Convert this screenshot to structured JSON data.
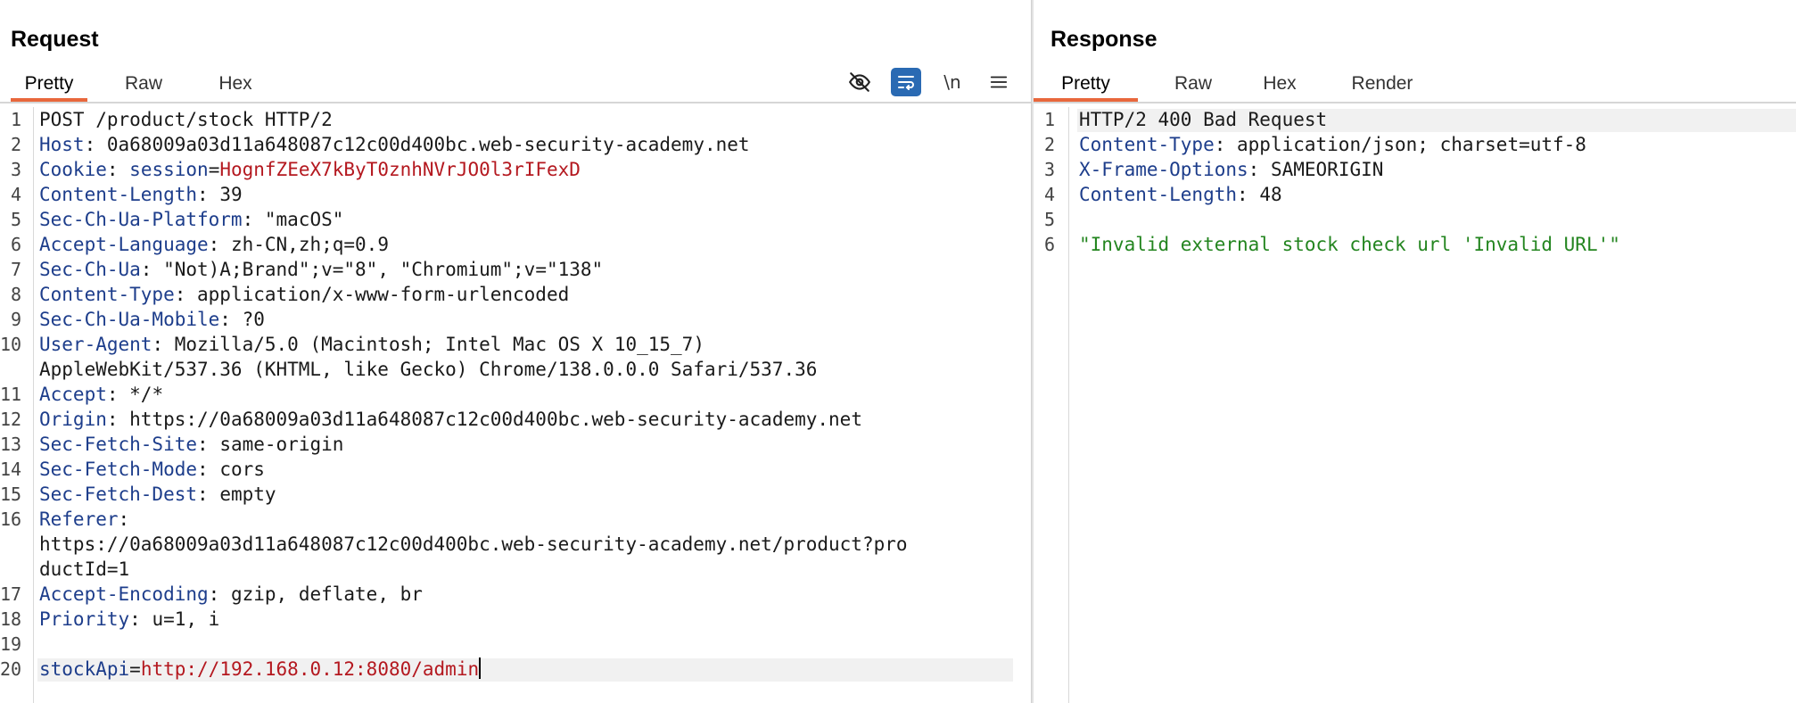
{
  "request": {
    "title": "Request",
    "tabs": [
      "Pretty",
      "Raw",
      "Hex"
    ],
    "active_tab": "Pretty",
    "toolbar": {
      "hide_icon": "eye-slash-icon",
      "wrap_icon": "word-wrap-icon",
      "newline_label": "\\n",
      "menu_icon": "hamburger-menu-icon"
    },
    "lines": [
      {
        "n": "1",
        "plain": "POST /product/stock HTTP/2"
      },
      {
        "n": "2",
        "key": "Host",
        "value": " 0a68009a03d11a648087c12c00d400bc.web-security-academy.net"
      },
      {
        "n": "3",
        "key": "Cookie",
        "subkey": "session",
        "cookie": "HognfZEeX7kByT0znhNVrJO0l3rIFexD"
      },
      {
        "n": "4",
        "key": "Content-Length",
        "value": " 39"
      },
      {
        "n": "5",
        "key": "Sec-Ch-Ua-Platform",
        "value": " \"macOS\""
      },
      {
        "n": "6",
        "key": "Accept-Language",
        "value": " zh-CN,zh;q=0.9"
      },
      {
        "n": "7",
        "key": "Sec-Ch-Ua",
        "value": " \"Not)A;Brand\";v=\"8\", \"Chromium\";v=\"138\""
      },
      {
        "n": "8",
        "key": "Content-Type",
        "value": " application/x-www-form-urlencoded"
      },
      {
        "n": "9",
        "key": "Sec-Ch-Ua-Mobile",
        "value": " ?0"
      },
      {
        "n": "10",
        "key": "User-Agent",
        "value": " Mozilla/5.0 (Macintosh; Intel Mac OS X 10_15_7)"
      },
      {
        "n": "",
        "plain": "AppleWebKit/537.36 (KHTML, like Gecko) Chrome/138.0.0.0 Safari/537.36"
      },
      {
        "n": "11",
        "key": "Accept",
        "value": " */*"
      },
      {
        "n": "12",
        "key": "Origin",
        "value": " https://0a68009a03d11a648087c12c00d400bc.web-security-academy.net"
      },
      {
        "n": "13",
        "key": "Sec-Fetch-Site",
        "value": " same-origin"
      },
      {
        "n": "14",
        "key": "Sec-Fetch-Mode",
        "value": " cors"
      },
      {
        "n": "15",
        "key": "Sec-Fetch-Dest",
        "value": " empty"
      },
      {
        "n": "16",
        "key": "Referer",
        "value": ""
      },
      {
        "n": "",
        "plain": "https://0a68009a03d11a648087c12c00d400bc.web-security-academy.net/product?pro"
      },
      {
        "n": "",
        "plain": "ductId=1"
      },
      {
        "n": "17",
        "key": "Accept-Encoding",
        "value": " gzip, deflate, br"
      },
      {
        "n": "18",
        "key": "Priority",
        "value": " u=1, i"
      },
      {
        "n": "19",
        "plain": ""
      },
      {
        "n": "20",
        "param": "stockApi",
        "paramval": "http://192.168.0.12:8080/admin",
        "highlight": true,
        "caret": true
      }
    ]
  },
  "response": {
    "title": "Response",
    "tabs": [
      "Pretty",
      "Raw",
      "Hex",
      "Render"
    ],
    "active_tab": "Pretty",
    "lines": [
      {
        "n": "1",
        "plain": "HTTP/2 400 Bad Request",
        "highlight": true
      },
      {
        "n": "2",
        "key": "Content-Type",
        "value": " application/json; charset=utf-8"
      },
      {
        "n": "3",
        "key": "X-Frame-Options",
        "value": " SAMEORIGIN"
      },
      {
        "n": "4",
        "key": "Content-Length",
        "value": " 48"
      },
      {
        "n": "5",
        "plain": ""
      },
      {
        "n": "6",
        "str": "\"Invalid external stock check url 'Invalid URL'\""
      }
    ]
  },
  "colors": {
    "accent_tab_underline": "#e8673c",
    "header_key": "#1d3d8b",
    "cookie_value": "#b4181f",
    "json_string": "#23851f",
    "wrap_button": "#2a6ab3"
  }
}
